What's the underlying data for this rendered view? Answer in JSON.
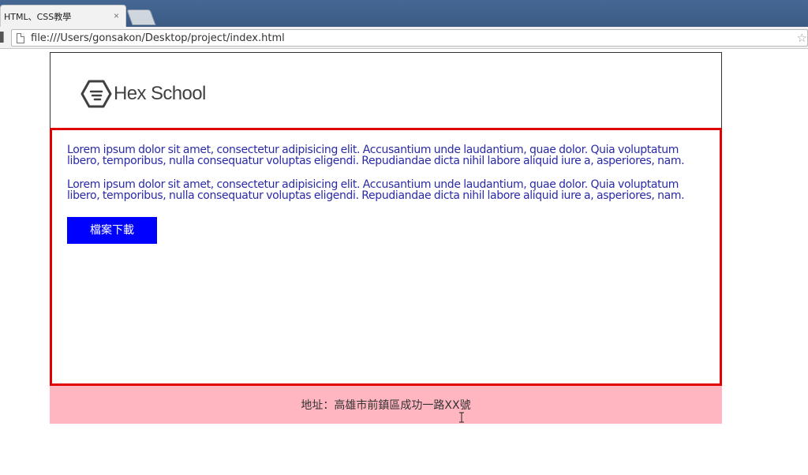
{
  "browser": {
    "tab": {
      "title": "HTML、CSS教學",
      "close_glyph": "×"
    },
    "address_bar": {
      "url": "file:///Users/gonsakon/Desktop/project/index.html"
    },
    "icons": [
      "page-icon",
      "bookmark-star-icon",
      "tab-close-icon"
    ]
  },
  "site": {
    "logo": {
      "text": "Hex School",
      "icon": "hexagon-logo-icon"
    },
    "paragraphs": [
      "Lorem ipsum dolor sit amet, consectetur adipisicing elit. Accusantium unde laudantium, quae dolor. Quia voluptatum libero, temporibus, nulla consequatur voluptas eligendi. Repudiandae dicta nihil labore aliquid iure a, asperiores, nam.",
      "Lorem ipsum dolor sit amet, consectetur adipisicing elit. Accusantium unde laudantium, quae dolor. Quia voluptatum libero, temporibus, nulla consequatur voluptas eligendi. Repudiandae dicta nihil labore aliquid iure a, asperiores, nam."
    ],
    "download_button_label": "檔案下載",
    "footer": {
      "address": "地址：高雄市前鎮區成功一路XX號"
    }
  },
  "colors": {
    "main_border": "#e00000",
    "paragraph_text": "#2a2aa8",
    "button_bg": "#0000ff",
    "footer_bg": "#ffb6c1"
  }
}
